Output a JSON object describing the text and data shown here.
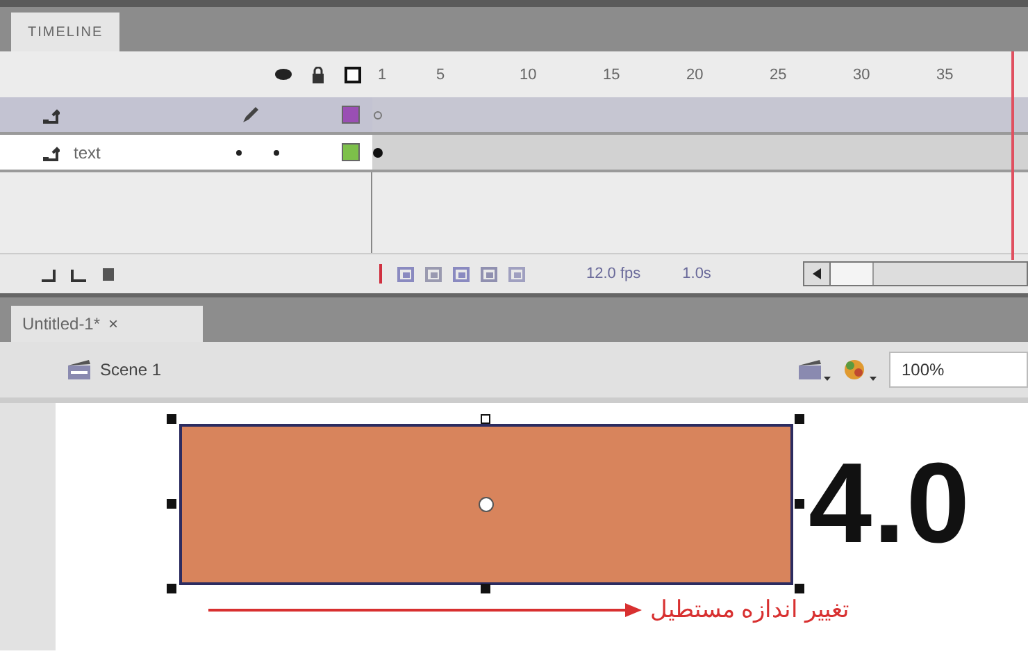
{
  "timeline": {
    "tab": "TIMELINE",
    "frame_numbers": [
      "1",
      "5",
      "10",
      "15",
      "20",
      "25",
      "30",
      "35"
    ],
    "layers": [
      {
        "selected": true,
        "editing": true,
        "color": "#9a4fb4"
      },
      {
        "name": "text",
        "selected": false,
        "editing": false,
        "color": "#7dc04a"
      }
    ],
    "frame_rate": "12.0 fps",
    "elapsed": "1.0s"
  },
  "document": {
    "tab": "Untitled-1*",
    "close": "×",
    "scene": "Scene 1",
    "zoom": "100%"
  },
  "stage": {
    "big_text": "4.0",
    "caption": "تغییر اندازه مستطیل"
  }
}
